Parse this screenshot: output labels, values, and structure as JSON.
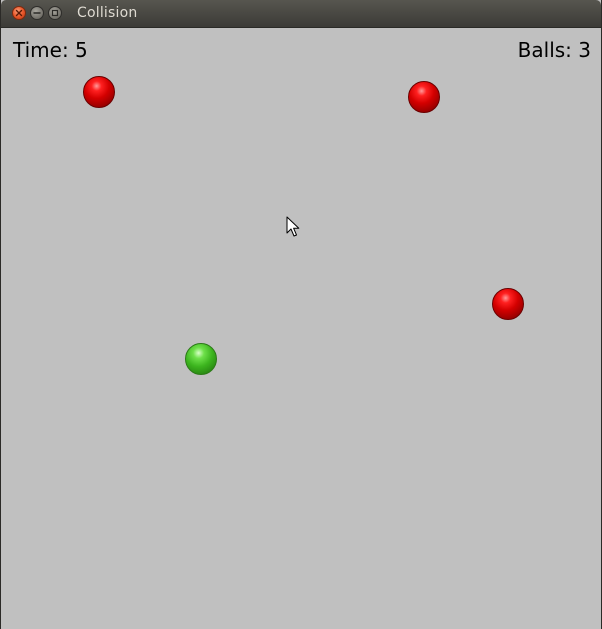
{
  "window": {
    "title": "Collision"
  },
  "hud": {
    "time_label": "Time: 5",
    "balls_label": "Balls: 3"
  },
  "balls": [
    {
      "color": "red",
      "fill": "#d40000"
    },
    {
      "color": "red",
      "fill": "#d40000"
    },
    {
      "color": "red",
      "fill": "#d40000"
    },
    {
      "color": "green",
      "fill": "#3cb41e"
    }
  ],
  "icons": {
    "close": "close-icon",
    "minimize": "minimize-icon",
    "maximize": "maximize-icon",
    "cursor": "mouse-cursor-icon"
  },
  "colors": {
    "background": "#c0c0c0",
    "titlebar": "#3c3b37",
    "title_text": "#dfdbd2"
  }
}
